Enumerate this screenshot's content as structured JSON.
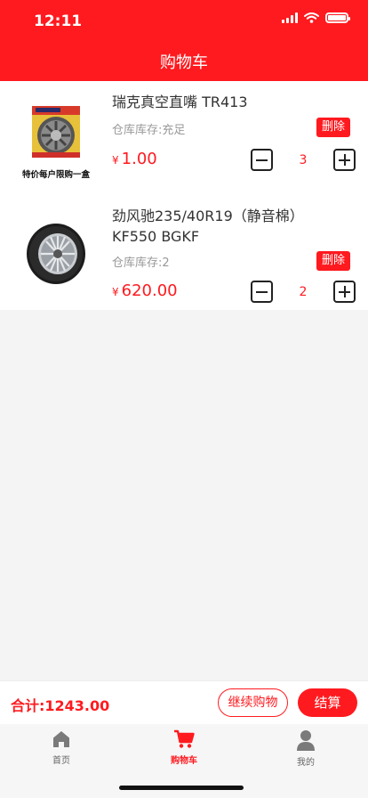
{
  "status_bar": {
    "time": "12:11"
  },
  "header": {
    "title": "购物车"
  },
  "items": [
    {
      "name": "瑞克真空直嘴 TR413",
      "stock": "仓库库存:充足",
      "delete_label": "删除",
      "currency": "¥",
      "price": "1.00",
      "quantity": "3",
      "image_caption": "特价每户限购一盒"
    },
    {
      "name": "劲风驰235/40R19（静音棉）KF550 BGKF",
      "stock": "仓库库存:2",
      "delete_label": "删除",
      "currency": "¥",
      "price": "620.00",
      "quantity": "2"
    }
  ],
  "summary": {
    "total": "合计:1243.00",
    "continue_label": "继续购物",
    "checkout_label": "结算"
  },
  "tabbar": {
    "tabs": [
      {
        "label": "首页",
        "icon": "home-icon",
        "active": false
      },
      {
        "label": "购物车",
        "icon": "cart-icon",
        "active": true
      },
      {
        "label": "我的",
        "icon": "user-icon",
        "active": false
      }
    ]
  },
  "colors": {
    "primary": "#ff1a1f",
    "background": "#f4f4f4",
    "text": "#333333",
    "muted": "#999999"
  }
}
